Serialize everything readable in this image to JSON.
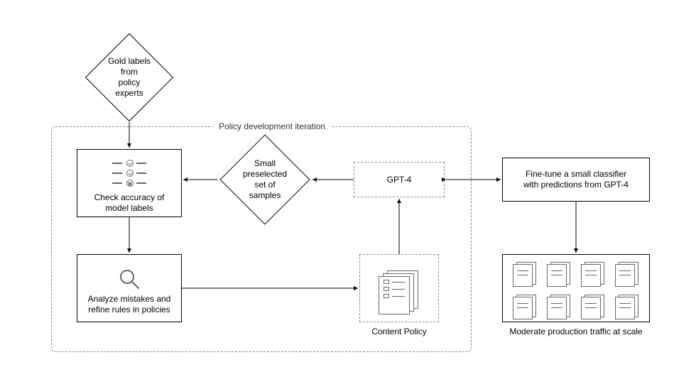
{
  "diagram": {
    "frame_label": "Policy development iteration",
    "nodes": {
      "gold_labels": {
        "label": "Gold labels from\npolicy experts"
      },
      "check_accuracy": {
        "label": "Check accuracy of\nmodel labels"
      },
      "small_set": {
        "label": "Small preselected\nset of samples"
      },
      "gpt4": {
        "label": "GPT-4"
      },
      "finetune": {
        "label": "Fine-tune a small classifier\nwith predictions from GPT-4"
      },
      "analyze": {
        "label": "Analyze mistakes and\nrefine rules in policies"
      },
      "content_policy": {
        "label": "Content Policy"
      },
      "moderate": {
        "label": "Moderate production traffic at scale"
      }
    },
    "edges": [
      {
        "from": "gold_labels",
        "to": "check_accuracy",
        "dir": "uni"
      },
      {
        "from": "small_set",
        "to": "check_accuracy",
        "dir": "uni"
      },
      {
        "from": "gpt4",
        "to": "small_set",
        "dir": "uni"
      },
      {
        "from": "gpt4",
        "to": "finetune",
        "dir": "bi"
      },
      {
        "from": "check_accuracy",
        "to": "analyze",
        "dir": "uni"
      },
      {
        "from": "analyze",
        "to": "content_policy",
        "dir": "uni"
      },
      {
        "from": "content_policy",
        "to": "gpt4",
        "dir": "uni"
      },
      {
        "from": "finetune",
        "to": "moderate",
        "dir": "uni"
      }
    ]
  }
}
